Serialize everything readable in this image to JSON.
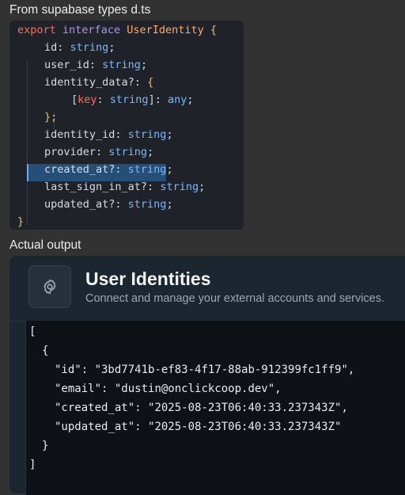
{
  "headings": {
    "types_heading": "From supabase types d.ts",
    "output_heading": "Actual output"
  },
  "code": {
    "l1_export": "export",
    "l1_interface": "interface",
    "l1_name": "UserIdentity",
    "l1_brace": "{",
    "l2_prop": "id",
    "l2_type": "string",
    "l3_prop": "user_id",
    "l3_type": "string",
    "l4_prop": "identity_data?",
    "l4_brace": "{",
    "l5_key": "key",
    "l5_type": "string",
    "l5_val": "any",
    "l6_close": "};",
    "l7_prop": "identity_id",
    "l7_type": "string",
    "l8_prop": "provider",
    "l8_type": "string",
    "l9_prop": "created_at?",
    "l9_type": "string",
    "l10_prop": "last_sign_in_at?",
    "l10_type": "string",
    "l11_prop": "updated_at?",
    "l11_type": "string",
    "l12_close": "}"
  },
  "card": {
    "icon": "gear-icon",
    "title": "User Identities",
    "subtitle": "Connect and manage your external accounts and services."
  },
  "json_output": {
    "open_bracket": "[",
    "open_brace": "{",
    "id_key": "\"id\"",
    "id_val": "\"3bd7741b-ef83-4f17-88ab-912399fc1ff9\"",
    "email_key": "\"email\"",
    "email_val": "\"dustin@onclickcoop.dev\"",
    "created_key": "\"created_at\"",
    "created_val": "\"2025-08-23T06:40:33.237343Z\"",
    "updated_key": "\"updated_at\"",
    "updated_val": "\"2025-08-23T06:40:33.237343Z\"",
    "close_brace": "}",
    "close_bracket": "]"
  }
}
